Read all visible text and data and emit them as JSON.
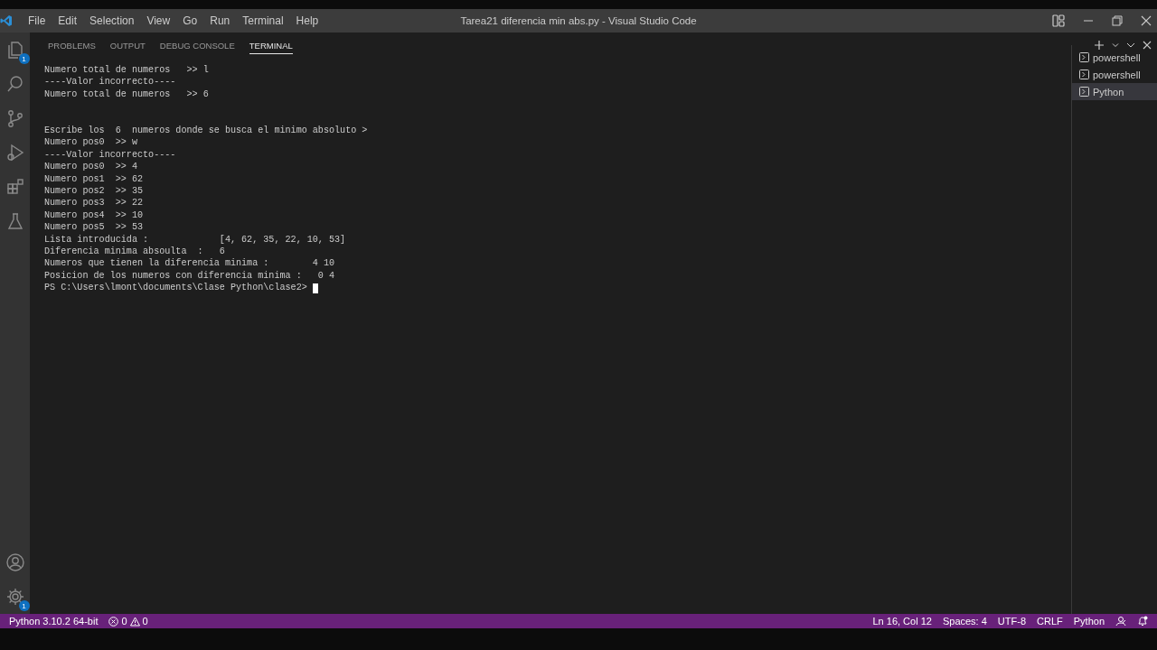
{
  "window": {
    "title": "Tarea21 diferencia min abs.py - Visual Studio Code"
  },
  "menu": [
    "File",
    "Edit",
    "Selection",
    "View",
    "Go",
    "Run",
    "Terminal",
    "Help"
  ],
  "activity_bar": {
    "explorer_badge": "1",
    "settings_badge": "1"
  },
  "panel_tabs": [
    {
      "label": "PROBLEMS",
      "selected": false
    },
    {
      "label": "OUTPUT",
      "selected": false
    },
    {
      "label": "DEBUG CONSOLE",
      "selected": false
    },
    {
      "label": "TERMINAL",
      "selected": true
    }
  ],
  "terminal": {
    "blocks": [
      [
        "Numero total de numeros   >> l",
        "----Valor incorrecto----",
        "Numero total de numeros   >> 6"
      ],
      [
        "Escribe los  6  numeros donde se busca el minimo absoluto >",
        "Numero pos0  >> w",
        "----Valor incorrecto----",
        "Numero pos0  >> 4",
        "Numero pos1  >> 62",
        "Numero pos2  >> 35",
        "Numero pos3  >> 22",
        "Numero pos4  >> 10",
        "Numero pos5  >> 53",
        "Lista introducida :             [4, 62, 35, 22, 10, 53]",
        "Diferencia minima absoulta  :   6",
        "Numeros que tienen la diferencia minima :        4 10",
        "Posicion de los numeros con diferencia minima :   0 4"
      ]
    ],
    "prompt": "PS C:\\Users\\lmont\\documents\\Clase Python\\clase2> "
  },
  "terminal_list": [
    {
      "label": "powershell",
      "selected": false
    },
    {
      "label": "powershell",
      "selected": false
    },
    {
      "label": "Python",
      "selected": true
    }
  ],
  "status_bar": {
    "interpreter": "Python 3.10.2 64-bit",
    "errors": "0",
    "warnings": "0",
    "right": [
      "Ln 16, Col 12",
      "Spaces: 4",
      "UTF-8",
      "CRLF",
      "Python"
    ]
  }
}
